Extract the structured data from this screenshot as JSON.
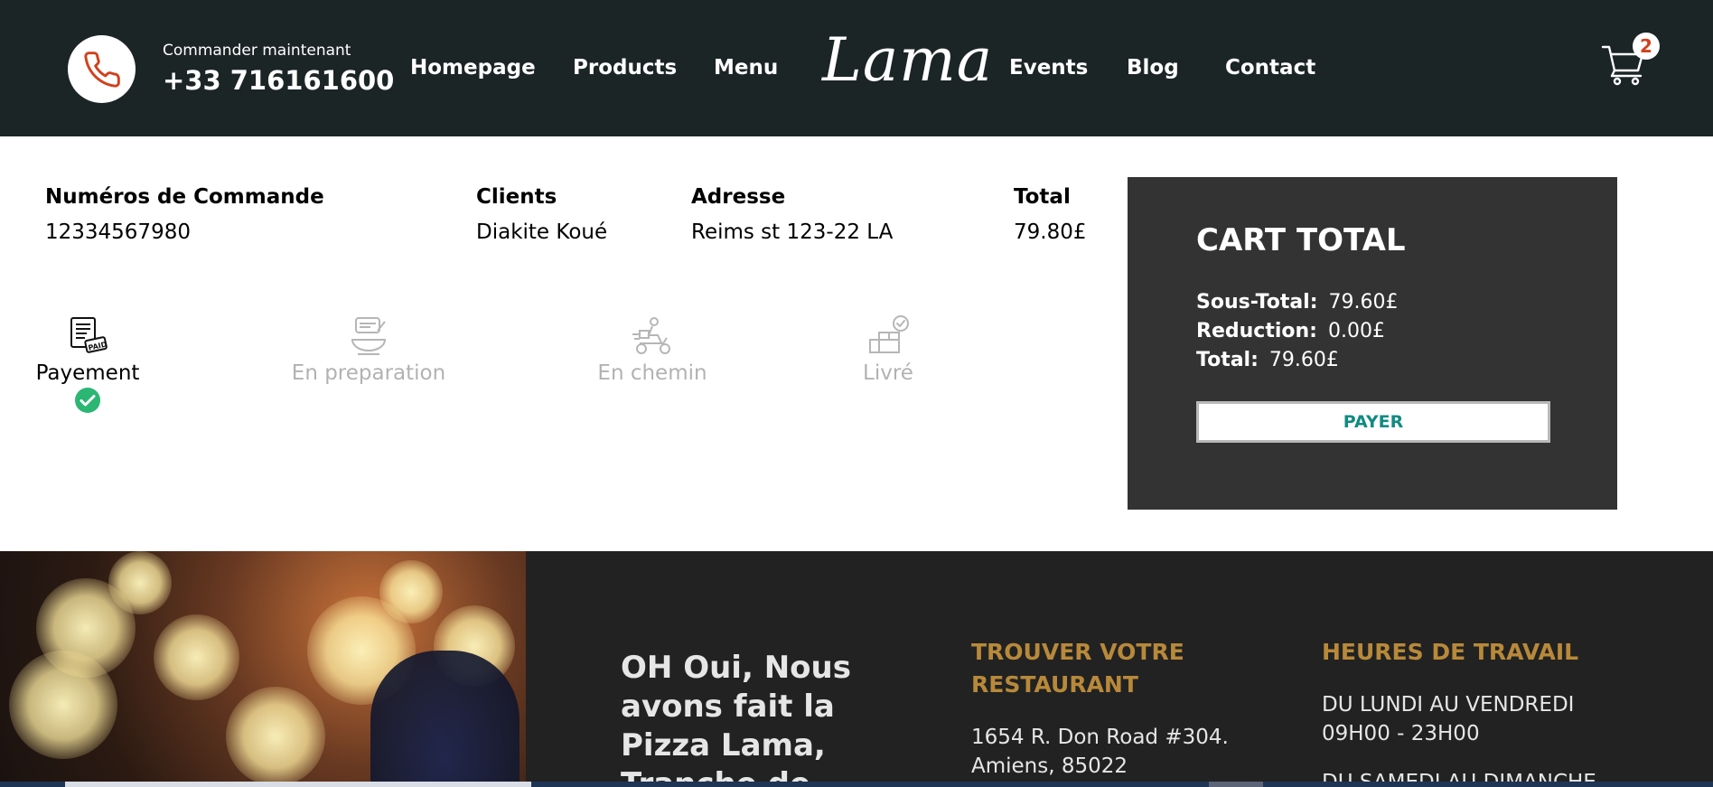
{
  "header": {
    "order_now": "Commander maintenant",
    "phone": "+33 716161600",
    "logo": "Lama",
    "nav": [
      "Homepage",
      "Products",
      "Menu",
      "Events",
      "Blog",
      "Contact"
    ],
    "cart_count": "2"
  },
  "order": {
    "headers": {
      "id": "Numéros de Commande",
      "client": "Clients",
      "address": "Adresse",
      "total": "Total"
    },
    "values": {
      "id": "12334567980",
      "client": "Diakite Koué",
      "address": "Reims st 123-22 LA",
      "total": "79.80£"
    }
  },
  "steps": [
    {
      "label": "Payement",
      "icon": "paid-invoice-icon",
      "done": true
    },
    {
      "label": "En preparation",
      "icon": "cooking-bowl-icon",
      "done": false
    },
    {
      "label": "En chemin",
      "icon": "delivery-scooter-icon",
      "done": false
    },
    {
      "label": "Livré",
      "icon": "delivered-package-icon",
      "done": false
    }
  ],
  "cart_total": {
    "title": "CART TOTAL",
    "subtotal_label": "Sous-Total:",
    "subtotal": "79.60£",
    "discount_label": "Reduction:",
    "discount": "0.00£",
    "total_label": "Total:",
    "total": "79.60£",
    "pay_label": "PAYER"
  },
  "footer": {
    "slogan": "OH Oui, Nous avons fait la Pizza Lama, Tranche de",
    "restaurant_heading": "TROUVER VOTRE RESTAURANT",
    "restaurant_address_line1": "1654 R. Don Road #304.",
    "restaurant_address_line2": "Amiens, 85022",
    "hours_heading": "HEURES DE TRAVAIL",
    "hours_weekdays": "DU LUNDI AU VENDREDI",
    "hours_weekdays_time": "09H00 - 23H00",
    "hours_weekend": "DU SAMEDI AU DIMANCHE"
  },
  "colors": {
    "header_bg": "#1c2526",
    "accent_red": "#d1411e",
    "panel_bg": "#333333",
    "pay_text": "#118b82",
    "footer_bg": "#222222",
    "footer_heading": "#b8893a",
    "check_green": "#2bb673"
  }
}
